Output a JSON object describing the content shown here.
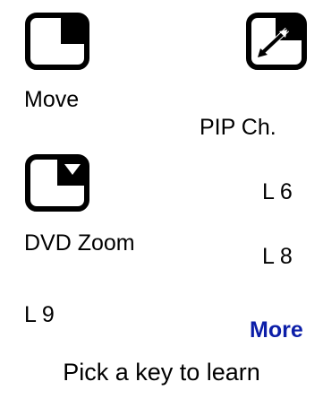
{
  "keys": {
    "move": {
      "label": "Move",
      "icon": "pip-move-icon"
    },
    "pip_ch": {
      "label": "PIP Ch.",
      "icon": "pip-resize-icon"
    },
    "dvd_zoom": {
      "label": "DVD Zoom",
      "icon": "pip-zoom-icon"
    },
    "l6": {
      "label": "L 6"
    },
    "l8": {
      "label": "L 8"
    },
    "l9": {
      "label": "L 9"
    },
    "more": {
      "label": "More"
    }
  },
  "colors": {
    "text": "#000000",
    "accent": "#0c1ea8",
    "background": "#ffffff"
  },
  "status": {
    "prompt": "Pick a key to learn"
  }
}
